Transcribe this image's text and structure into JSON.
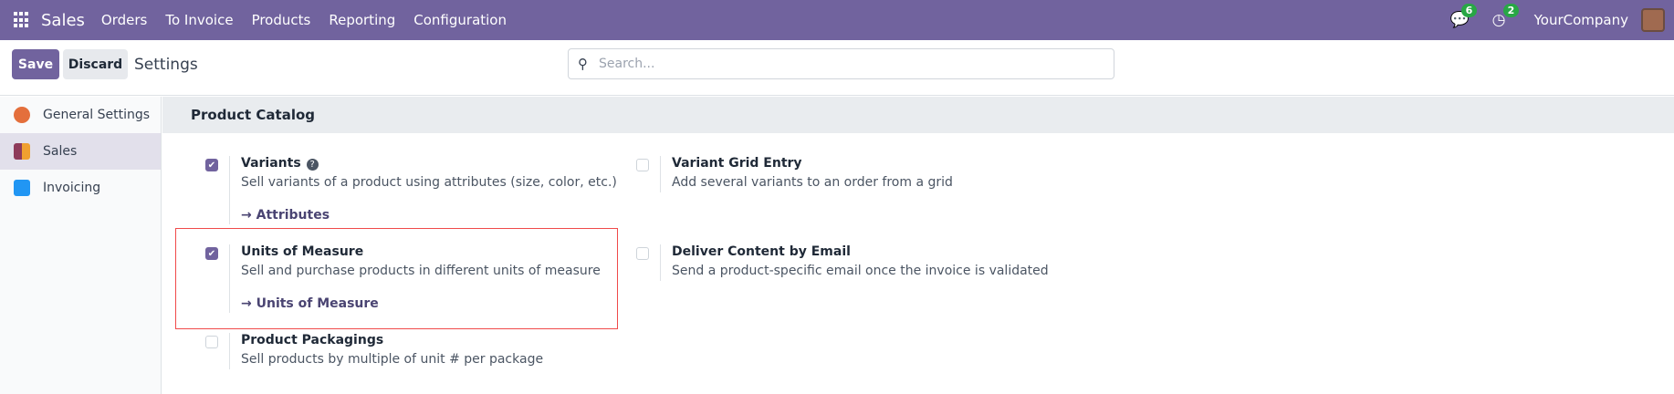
{
  "navbar": {
    "app": "Sales",
    "menu": [
      "Orders",
      "To Invoice",
      "Products",
      "Reporting",
      "Configuration"
    ],
    "messages_count": "6",
    "activities_count": "2",
    "company": "YourCompany"
  },
  "control_panel": {
    "save": "Save",
    "discard": "Discard",
    "title": "Settings",
    "search_placeholder": "Search..."
  },
  "sidebar": [
    {
      "label": "General Settings",
      "color": "#e46f3c"
    },
    {
      "label": "Sales",
      "color": "#f0a030"
    },
    {
      "label": "Invoicing",
      "color": "#2196f3"
    }
  ],
  "section": {
    "title": "Product Catalog"
  },
  "settings": [
    {
      "label": "Variants",
      "desc": "Sell variants of a product using attributes (size, color, etc.)",
      "checked": true,
      "link": "Attributes"
    },
    {
      "label": "Variant Grid Entry",
      "desc": "Add several variants to an order from a grid",
      "checked": false
    },
    {
      "label": "Units of Measure",
      "desc": "Sell and purchase products in different units of measure",
      "checked": true,
      "link": "Units of Measure"
    },
    {
      "label": "Deliver Content by Email",
      "desc": "Send a product-specific email once the invoice is validated",
      "checked": false
    },
    {
      "label": "Product Packagings",
      "desc": "Sell products by multiple of unit # per package",
      "checked": false
    }
  ],
  "icons": {
    "arrow": "→"
  }
}
